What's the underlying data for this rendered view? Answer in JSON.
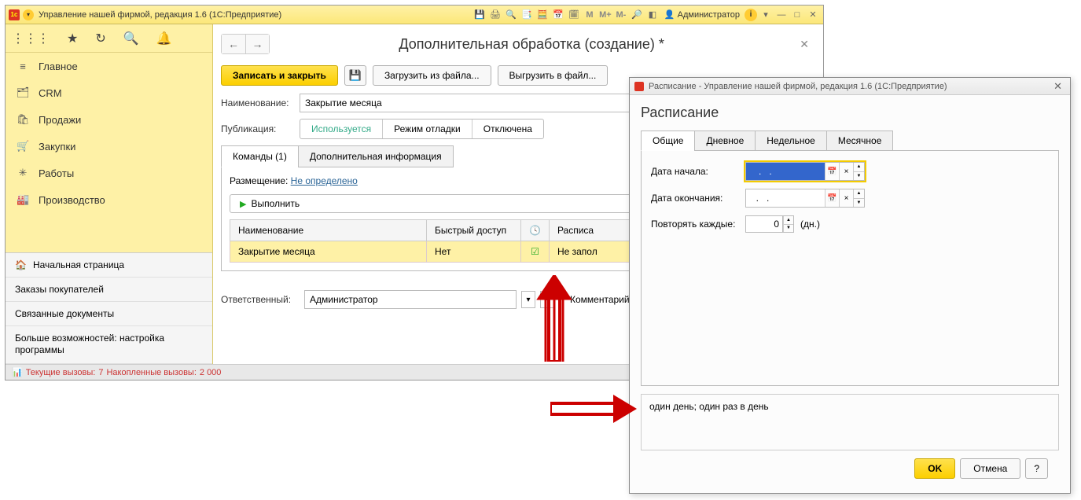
{
  "titlebar": {
    "title": "Управление нашей фирмой, редакция 1.6  (1С:Предприятие)",
    "admin_label": "Администратор",
    "mem": {
      "m": "M",
      "mplus": "M+",
      "mminus": "M-"
    }
  },
  "sidebar": {
    "items": [
      {
        "icon": "≡",
        "label": "Главное"
      },
      {
        "icon": "🗂",
        "label": "CRM"
      },
      {
        "icon": "🛍",
        "label": "Продажи"
      },
      {
        "icon": "🛒",
        "label": "Закупки"
      },
      {
        "icon": "✳",
        "label": "Работы"
      },
      {
        "icon": "🏭",
        "label": "Производство"
      }
    ],
    "bottom": {
      "home": "Начальная страница",
      "orders": "Заказы покупателей",
      "linked": "Связанные документы",
      "more": "Больше возможностей: настройка программы"
    }
  },
  "content": {
    "title": "Дополнительная обработка (создание) *",
    "buttons": {
      "save_close": "Записать и закрыть",
      "load_file": "Загрузить из файла...",
      "export_file": "Выгрузить в файл..."
    },
    "fields": {
      "name_label": "Наименование:",
      "name_value": "Закрытие месяца",
      "pub_label": "Публикация:",
      "pub_options": [
        "Используется",
        "Режим отладки",
        "Отключена"
      ],
      "resp_label": "Ответственный:",
      "resp_value": "Администратор",
      "comment_label": "Комментарий:"
    },
    "tabs": [
      "Команды (1)",
      "Дополнительная информация"
    ],
    "placement_label": "Размещение:",
    "placement_link": "Не определено",
    "execute_btn": "Выполнить",
    "table": {
      "headers": {
        "name": "Наименование",
        "quick": "Быстрый доступ",
        "schedule": "Расписа"
      },
      "row": {
        "name": "Закрытие месяца",
        "quick": "Нет",
        "schedule": "Не запол"
      }
    }
  },
  "dialog": {
    "title": "Расписание - Управление нашей фирмой, редакция 1.6  (1С:Предприятие)",
    "heading": "Расписание",
    "tabs": [
      "Общие",
      "Дневное",
      "Недельное",
      "Месячное"
    ],
    "fields": {
      "start_label": "Дата начала:",
      "start_value": "   .   .   ",
      "end_label": "Дата окончания:",
      "end_value": "  .   .",
      "repeat_label": "Повторять каждые:",
      "repeat_value": "0",
      "repeat_unit": "(дн.)"
    },
    "summary": "один день; один раз в день",
    "buttons": {
      "ok": "OK",
      "cancel": "Отмена",
      "help": "?"
    }
  },
  "statusbar": {
    "current_label": "Текущие вызовы:",
    "current_value": "7",
    "accum_label": "Накопленные вызовы:",
    "accum_value": "2 000"
  }
}
